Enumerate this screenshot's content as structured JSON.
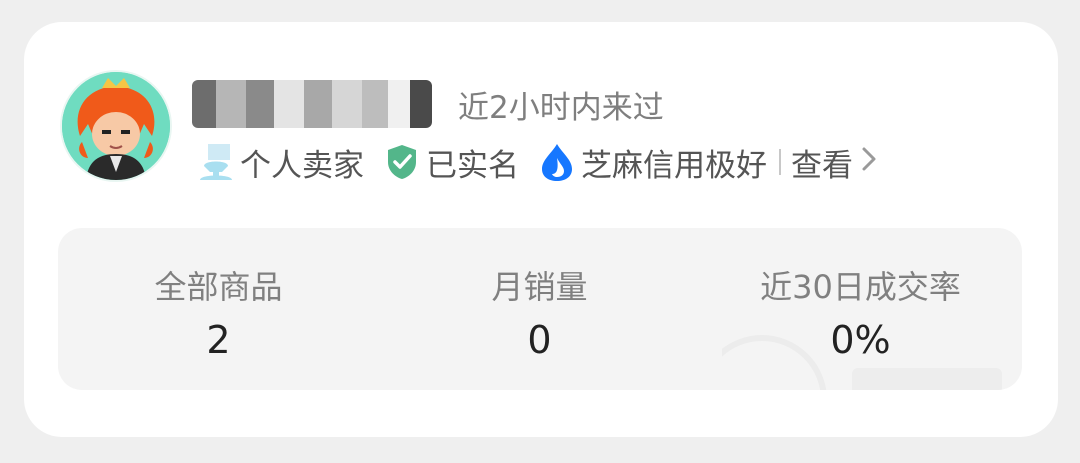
{
  "profile": {
    "last_seen": "近2小时内来过"
  },
  "badges": {
    "seller_type": "个人卖家",
    "verified": "已实名",
    "credit": "芝麻信用极好",
    "view_link": "查看"
  },
  "stats": [
    {
      "label": "全部商品",
      "value": "2"
    },
    {
      "label": "月销量",
      "value": "0"
    },
    {
      "label": "近30日成交率",
      "value": "0%"
    }
  ],
  "colors": {
    "card_bg": "#ffffff",
    "page_bg": "#efefef",
    "stats_bg": "#f4f4f4",
    "verified_green": "#53b68a",
    "credit_blue": "#1677ff",
    "seller_icon": "#a9dff0"
  },
  "icons": {
    "seller_type": "person-cup-icon",
    "verified": "shield-check-icon",
    "credit": "sesame-drop-icon",
    "view_link": "chevron-right-icon"
  }
}
